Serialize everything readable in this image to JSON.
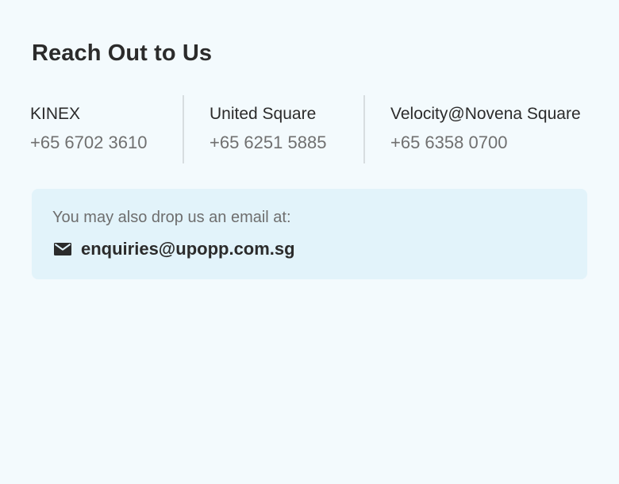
{
  "page": {
    "title": "Reach Out to Us"
  },
  "locations": [
    {
      "name": "KINEX",
      "phone": "+65 6702 3610"
    },
    {
      "name": "United Square",
      "phone": "+65 6251 5885"
    },
    {
      "name": "Velocity@Novena Square",
      "phone": "+65 6358 0700"
    }
  ],
  "email_section": {
    "hint": "You may also drop us an email at:",
    "email": "enquiries@upopp.com.sg",
    "icon": "mail-icon"
  },
  "colors": {
    "background": "#f3fafd",
    "email_box": "#e2f3fa",
    "text_primary": "#2b2b2b",
    "text_secondary": "#707070",
    "divider": "#d7dde0"
  }
}
